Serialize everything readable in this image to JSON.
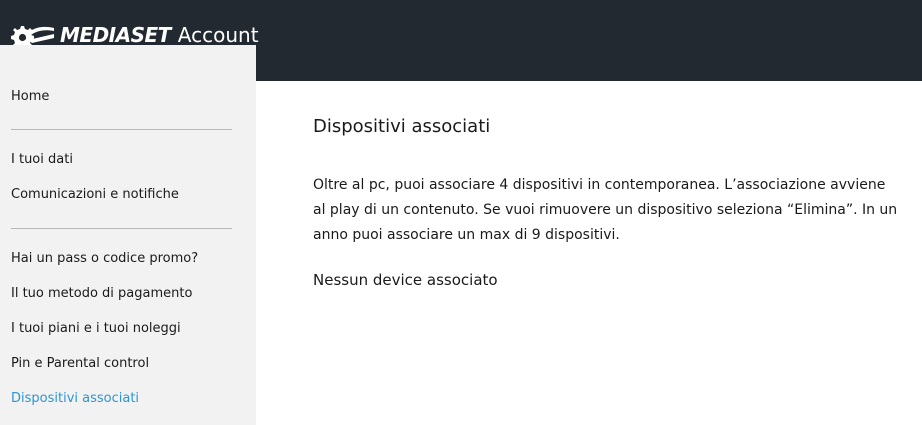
{
  "header": {
    "brand": "MEDIASET",
    "brand_sub": "Account",
    "logo_icon": "mediaset-biscione-icon",
    "background": "#232931"
  },
  "sidebar": {
    "background": "#f2f2f2",
    "active_color": "#2d95d3",
    "items": [
      {
        "label": "Home"
      },
      {
        "label": "I tuoi dati"
      },
      {
        "label": "Comunicazioni e notifiche"
      },
      {
        "label": "Hai un pass o codice promo?"
      },
      {
        "label": "Il tuo metodo di pagamento"
      },
      {
        "label": "I tuoi piani e i tuoi noleggi"
      },
      {
        "label": "Pin e Parental control"
      },
      {
        "label": "Dispositivi associati",
        "active": true
      }
    ]
  },
  "main": {
    "title": "Dispositivi associati",
    "description": "Oltre al pc, puoi associare 4 dispositivi in contemporanea. L’associazione avviene al play di un contenuto. Se vuoi rimuovere un dispositivo seleziona “Elimina”. In un anno puoi associare un max di 9 dispositivi.",
    "empty_state": "Nessun device associato"
  }
}
